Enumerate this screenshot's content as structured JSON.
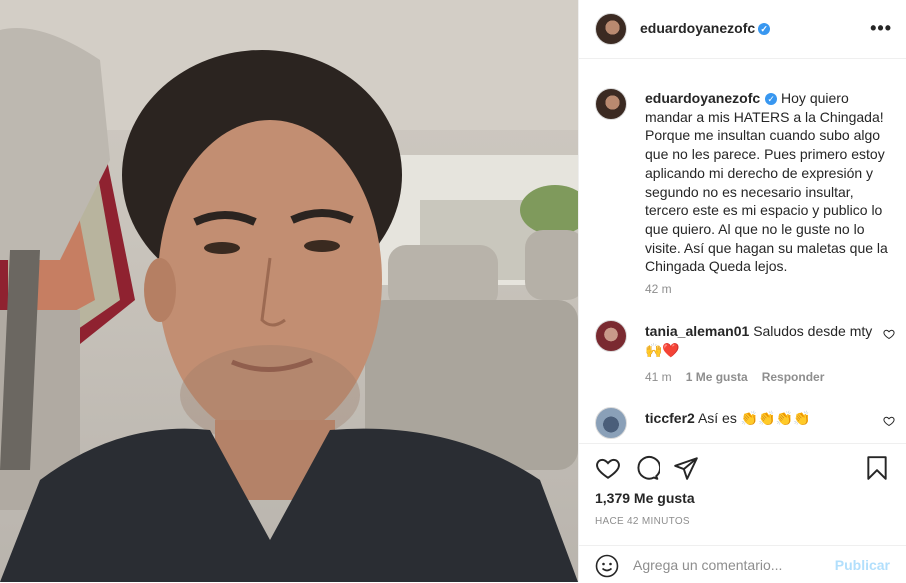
{
  "post": {
    "username": "eduardoyanezofc",
    "verified": true,
    "caption": "Hoy quiero mandar a mis HATERS a la Chingada! Porque me insultan cuando subo algo que no les parece. Pues primero estoy aplicando mi derecho de expresión y segundo no es necesario insultar, tercero este es mi espacio y publico lo que quiero. Al que no le guste no lo visite. Así que hagan su maletas que la Chingada Queda lejos.",
    "caption_time": "42 m",
    "likes": "1,379 Me gusta",
    "posted_ago": "HACE 42 MINUTOS"
  },
  "comments": [
    {
      "username": "tania_aleman01",
      "text": "Saludos desde mty🙌❤️",
      "time": "41 m",
      "likes": "1 Me gusta",
      "reply_label": "Responder"
    },
    {
      "username": "ticcfer2",
      "text": "Así es 👏👏👏👏",
      "time": "",
      "likes": "",
      "reply_label": ""
    }
  ],
  "composer": {
    "placeholder": "Agrega un comentario...",
    "publish_label": "Publicar"
  },
  "icons": {
    "more": "more-options-icon",
    "like": "heart-icon",
    "comment": "comment-icon",
    "share": "share-icon",
    "save": "bookmark-icon",
    "emoji": "emoji-icon"
  },
  "colors": {
    "verified": "#3897f0",
    "muted_text": "#8e8e8e",
    "publish_disabled": "#b2dffc",
    "border": "#efefef"
  }
}
